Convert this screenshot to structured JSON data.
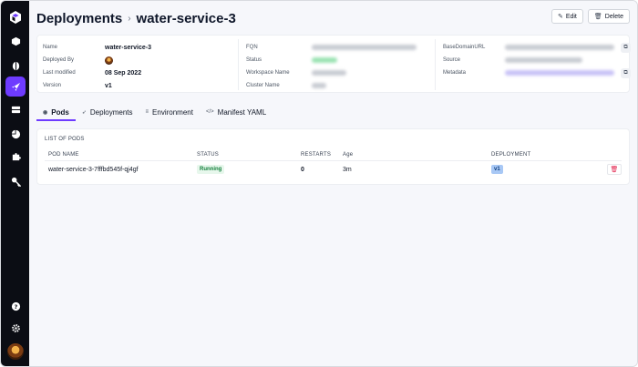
{
  "sidebar": {
    "logo_icon": "cube-logo-icon",
    "items": [
      {
        "icon": "box-icon",
        "active": false
      },
      {
        "icon": "bulb-icon",
        "active": false
      },
      {
        "icon": "rocket-icon",
        "active": true
      },
      {
        "icon": "server-icon",
        "active": false
      },
      {
        "icon": "pie-chart-icon",
        "active": false
      },
      {
        "icon": "puzzle-icon",
        "active": false
      },
      {
        "icon": "key-icon",
        "active": false
      }
    ],
    "bottom": [
      {
        "icon": "help-icon"
      },
      {
        "icon": "gear-icon"
      }
    ]
  },
  "header": {
    "breadcrumb_root": "Deployments",
    "separator": "›",
    "title": "water-service-3",
    "edit_label": "Edit",
    "delete_label": "Delete"
  },
  "info": {
    "name_label": "Name",
    "name_value": "water-service-3",
    "deployed_by_label": "Deployed By",
    "last_modified_label": "Last modified",
    "last_modified_value": "08 Sep 2022",
    "version_label": "Version",
    "version_value": "v1",
    "fqn_label": "FQN",
    "status_label": "Status",
    "workspace_label": "Workspace Name",
    "cluster_label": "Cluster Name",
    "base_domain_label": "BaseDomainURL",
    "source_label": "Source",
    "metadata_label": "Metadata"
  },
  "tabs": [
    {
      "label": "Pods",
      "icon": "pod-icon",
      "glyph": "◉",
      "active": true
    },
    {
      "label": "Deployments",
      "icon": "rocket-icon",
      "glyph": "➶",
      "active": false
    },
    {
      "label": "Environment",
      "icon": "env-icon",
      "glyph": "≡",
      "active": false
    },
    {
      "label": "Manifest YAML",
      "icon": "code-icon",
      "glyph": "</>",
      "active": false
    }
  ],
  "pods": {
    "title": "LIST OF PODS",
    "columns": {
      "pod_name": "POD NAME",
      "status": "STATUS",
      "restarts": "RESTARTS",
      "age": "Age",
      "deployment": "DEPLOYMENT"
    },
    "rows": [
      {
        "pod_name": "water-service-3-7fffbd545f-qj4gf",
        "status": "Running",
        "restarts": "0",
        "age": "3m",
        "deployment": "v1"
      }
    ]
  },
  "colors": {
    "accent": "#6e3bff",
    "sidebar_bg": "#0b0d14",
    "running_green": "#15803d",
    "deployment_badge": "#a8c8f5",
    "delete_red": "#e11d48"
  }
}
